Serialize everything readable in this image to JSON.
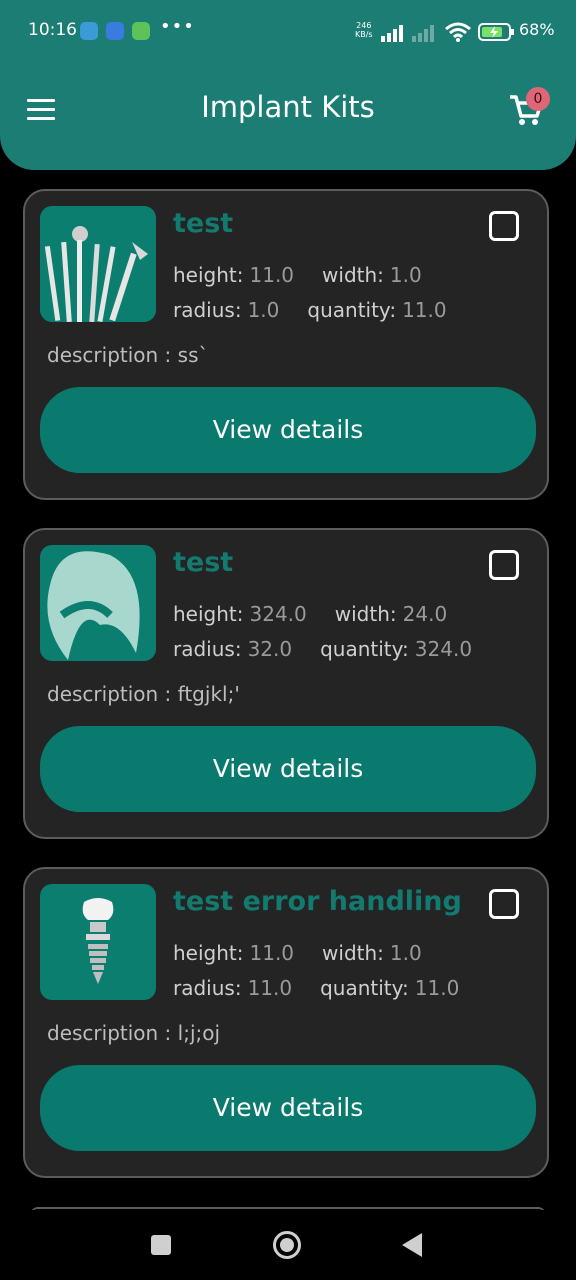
{
  "status_bar": {
    "time": "10:16",
    "network_speed_value": "246",
    "network_speed_unit": "KB/s",
    "battery": "68%",
    "overflow": "•••"
  },
  "header": {
    "title": "Implant Kits",
    "cart_count": "0"
  },
  "kits": [
    {
      "name": "test",
      "height_label": "height:",
      "height": "11.0",
      "width_label": "width:",
      "width": "1.0",
      "radius_label": "radius:",
      "radius": "1.0",
      "quantity_label": "quantity:",
      "quantity": "11.0",
      "description": "description : ss`",
      "button": "View details"
    },
    {
      "name": "test",
      "height_label": "height:",
      "height": "324.0",
      "width_label": "width:",
      "width": "24.0",
      "radius_label": "radius:",
      "radius": "32.0",
      "quantity_label": "quantity:",
      "quantity": "324.0",
      "description": "description : ftgjkl;'",
      "button": "View details"
    },
    {
      "name": "test error handling",
      "height_label": "height:",
      "height": "11.0",
      "width_label": "width:",
      "width": "1.0",
      "radius_label": "radius:",
      "radius": "11.0",
      "quantity_label": "quantity:",
      "quantity": "11.0",
      "description": "description : l;j;oj",
      "button": "View details"
    }
  ],
  "colors": {
    "primary": "#1b7d74",
    "card_bg": "#242424",
    "badge": "#e06677"
  }
}
